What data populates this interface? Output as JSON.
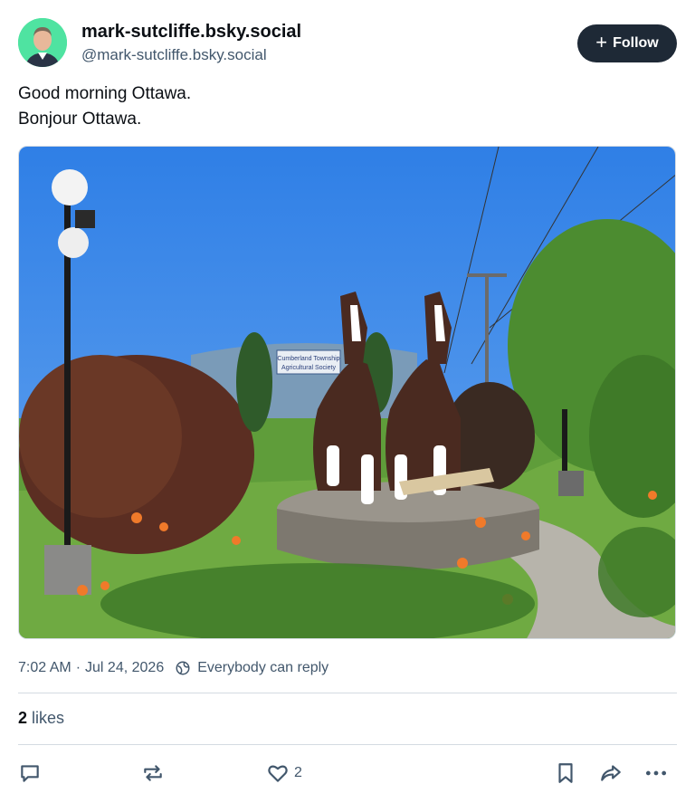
{
  "author": {
    "display_name": "mark-sutcliffe.bsky.social",
    "handle": "@mark-sutcliffe.bsky.social",
    "avatar_icon": "user-avatar-photo"
  },
  "follow_button": {
    "label": "Follow",
    "icon": "plus-icon"
  },
  "post": {
    "lines": [
      "Good morning Ottawa.",
      "Bonjour Ottawa."
    ],
    "image_sign_text": [
      "Cumberland Township",
      "Agricultural Society"
    ]
  },
  "meta": {
    "time": "7:02 AM",
    "separator": "·",
    "date": "Jul 24, 2026",
    "reply_setting": "Everybody can reply"
  },
  "likes": {
    "count": "2",
    "label": "likes"
  },
  "actions": {
    "like_count": "2"
  },
  "colors": {
    "text_primary": "#0b0f14",
    "text_secondary": "#42576c",
    "follow_bg": "#1e2936",
    "divider": "#d4dbe2"
  }
}
